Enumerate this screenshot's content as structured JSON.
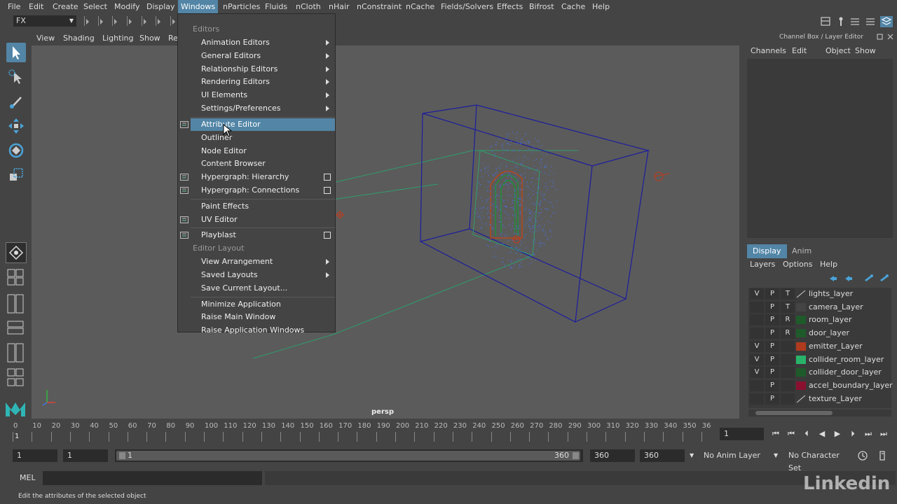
{
  "menubar": {
    "items": [
      "File",
      "Edit",
      "Create",
      "Select",
      "Modify",
      "Display",
      "Windows",
      "nParticles",
      "Fluids",
      "nCloth",
      "nHair",
      "nConstraint",
      "nCache",
      "Fields/Solvers",
      "Effects",
      "Bifrost",
      "Cache",
      "Help"
    ],
    "active": "Windows"
  },
  "mode_selector": {
    "value": "FX"
  },
  "viewport": {
    "menu": [
      "View",
      "Shading",
      "Lighting",
      "Show",
      "Re"
    ],
    "camera_label": "persp"
  },
  "windows_menu": {
    "sections": [
      {
        "header": "Editors",
        "items": [
          {
            "label": "Animation Editors",
            "submenu": true
          },
          {
            "label": "General Editors",
            "submenu": true
          },
          {
            "label": "Relationship Editors",
            "submenu": true
          },
          {
            "label": "Rendering Editors",
            "submenu": true
          },
          {
            "label": "UI Elements",
            "submenu": true
          },
          {
            "label": "Settings/Preferences",
            "submenu": true
          },
          {
            "label": "Attribute Editor",
            "highlighted": true,
            "icon": "attribute-editor-icon"
          },
          {
            "label": "Outliner"
          },
          {
            "label": "Node Editor"
          },
          {
            "label": "Content Browser"
          },
          {
            "label": "Hypergraph: Hierarchy",
            "option_box": true,
            "icon": "hypergraph-icon"
          },
          {
            "label": "Hypergraph: Connections",
            "option_box": true,
            "icon": "hypergraph-icon"
          },
          {
            "label": "Paint Effects"
          },
          {
            "label": "UV Editor",
            "icon": "uv-editor-icon"
          },
          {
            "label": "Playblast",
            "option_box": true,
            "icon": "playblast-icon"
          }
        ]
      },
      {
        "header": "Editor Layout",
        "items": [
          {
            "label": "View Arrangement",
            "submenu": true
          },
          {
            "label": "Saved Layouts",
            "submenu": true
          },
          {
            "label": "Save Current Layout..."
          },
          {
            "label": "Minimize Application"
          },
          {
            "label": "Raise Main Window"
          },
          {
            "label": "Raise Application Windows"
          }
        ]
      }
    ]
  },
  "channel_box": {
    "title": "Channel Box / Layer Editor",
    "menu": [
      "Channels",
      "Edit",
      "Object",
      "Show"
    ]
  },
  "layer_editor": {
    "tabs": [
      "Display",
      "Anim"
    ],
    "active_tab": "Display",
    "menu": [
      "Layers",
      "Options",
      "Help"
    ],
    "layers": [
      {
        "v": "V",
        "p": "P",
        "t": "T",
        "color": "",
        "name": "lights_layer"
      },
      {
        "v": "",
        "p": "P",
        "t": "T",
        "color": "#444444",
        "name": "camera_Layer"
      },
      {
        "v": "",
        "p": "P",
        "t": "R",
        "color": "#1e5a2a",
        "name": "room_layer"
      },
      {
        "v": "",
        "p": "P",
        "t": "R",
        "color": "#1e5a2a",
        "name": "door_layer"
      },
      {
        "v": "V",
        "p": "P",
        "t": "",
        "color": "#b03a1e",
        "name": "emitter_Layer"
      },
      {
        "v": "V",
        "p": "P",
        "t": "",
        "color": "#29b36a",
        "name": "collider_room_layer"
      },
      {
        "v": "V",
        "p": "P",
        "t": "",
        "color": "#1e5a2a",
        "name": "collider_door_layer"
      },
      {
        "v": "",
        "p": "P",
        "t": "",
        "color": "#8a1030",
        "name": "accel_boundary_layer"
      },
      {
        "v": "",
        "p": "P",
        "t": "",
        "color": "",
        "name": "texture_Layer"
      }
    ]
  },
  "timeline": {
    "ticks": [
      "0",
      "10",
      "20",
      "30",
      "40",
      "50",
      "60",
      "70",
      "80",
      "90",
      "100",
      "110",
      "120",
      "130",
      "140",
      "150",
      "160",
      "170",
      "180",
      "190",
      "200",
      "210",
      "220",
      "230",
      "240",
      "250",
      "260",
      "270",
      "280",
      "290",
      "300",
      "310",
      "320",
      "330",
      "340",
      "350",
      "36"
    ],
    "current_marker": "1",
    "current_frame": "1"
  },
  "range": {
    "start": "1",
    "playback_start": "1",
    "slider_start": "1",
    "slider_end": "360",
    "playback_end": "360",
    "end": "360",
    "anim_layer": "No Anim Layer",
    "character_set": "No Character Set"
  },
  "command_line": {
    "label": "MEL"
  },
  "help_line": {
    "text": "Edit the attributes of the selected object"
  },
  "watermark": "Linkedin"
}
